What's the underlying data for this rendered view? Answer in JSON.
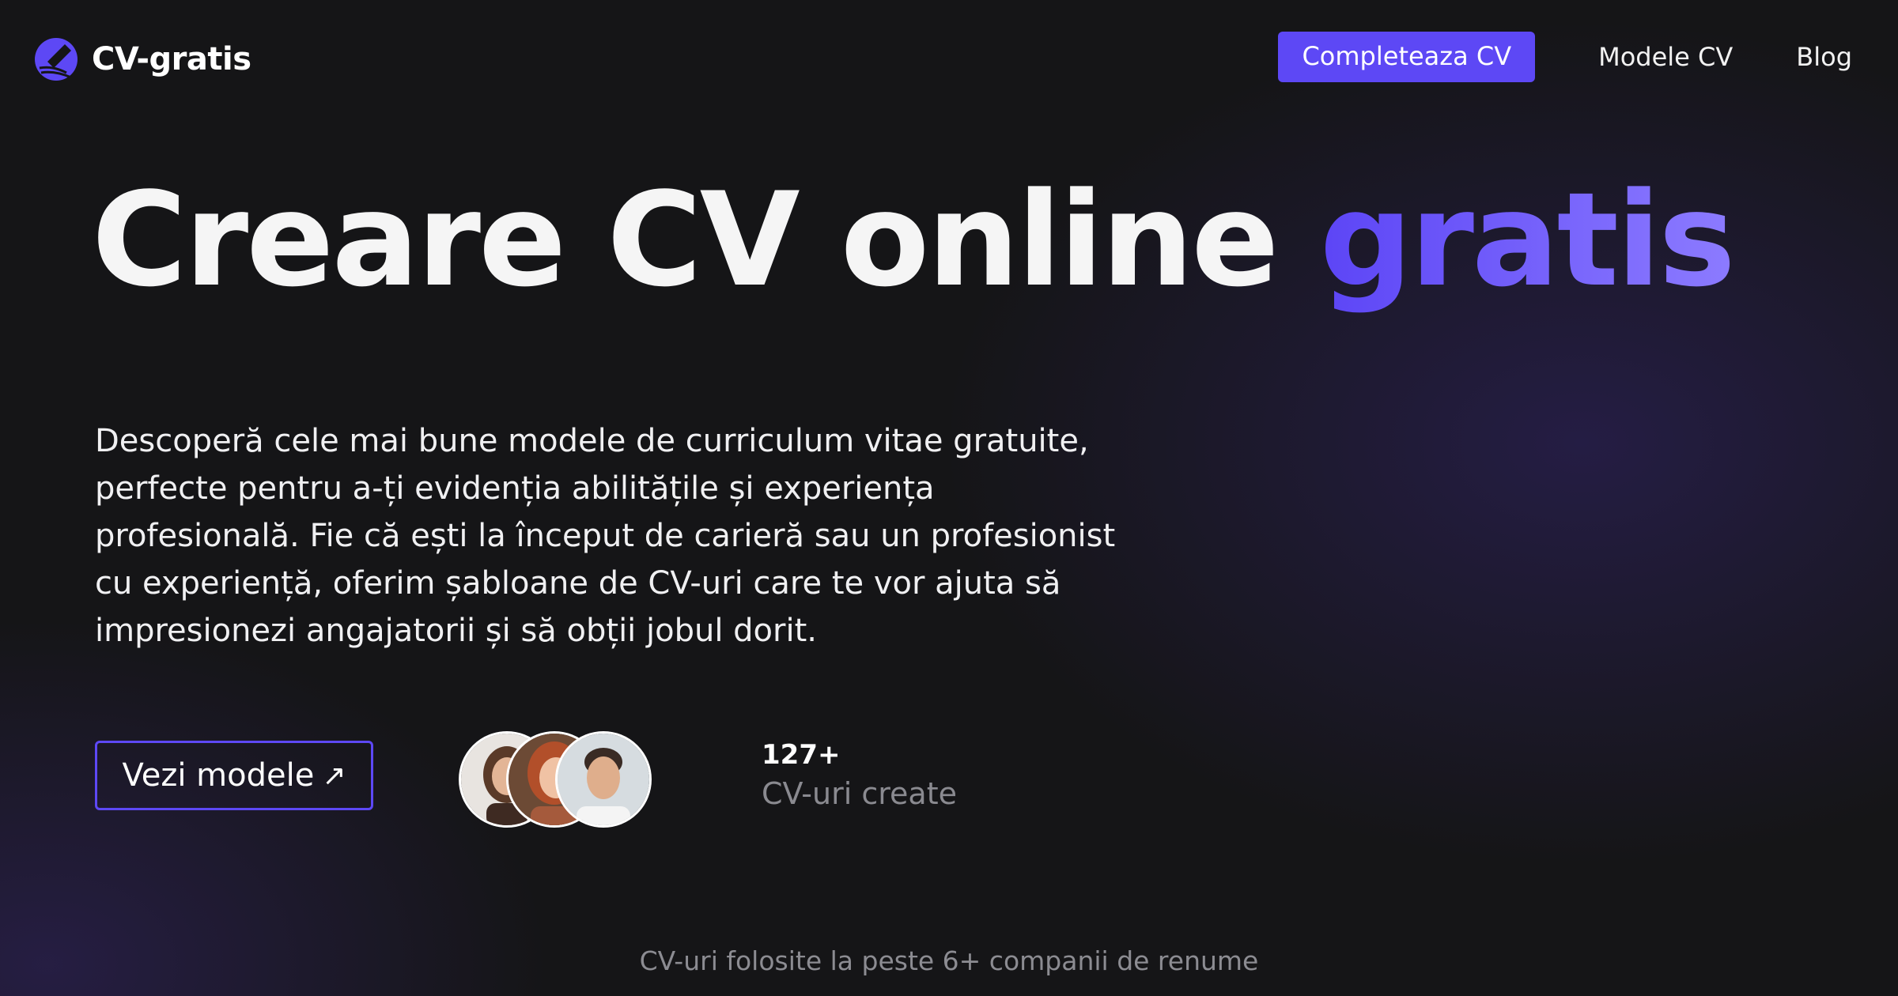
{
  "header": {
    "brand": "CV-gratis",
    "logo_icon": "pen-nib-logo-icon",
    "nav": {
      "cta_label": "Completeaza CV",
      "models_label": "Modele CV",
      "blog_label": "Blog"
    }
  },
  "hero": {
    "title_main": "Creare CV online",
    "title_accent": "gratis",
    "description": "Descoperă cele mai bune modele de curriculum vitae gratuite, perfecte pentru a-ți evidenția abilitățile și experiența profesională. Fie că ești la început de carieră sau un profesionist cu experiență, oferim șabloane de CV-uri care te vor ajuta să impresionezi angajatorii și să obții jobul dorit.",
    "button_label": "Vezi modele",
    "button_icon": "arrow-up-right-icon",
    "stat_value": "127+",
    "stat_label": "CV-uri create"
  },
  "footer_note": "CV-uri folosite la peste 6+ companii de renume",
  "colors": {
    "background": "#151517",
    "accent": "#5d48f5",
    "accent_light": "#8c7bff",
    "muted_text": "#8a8a90"
  }
}
